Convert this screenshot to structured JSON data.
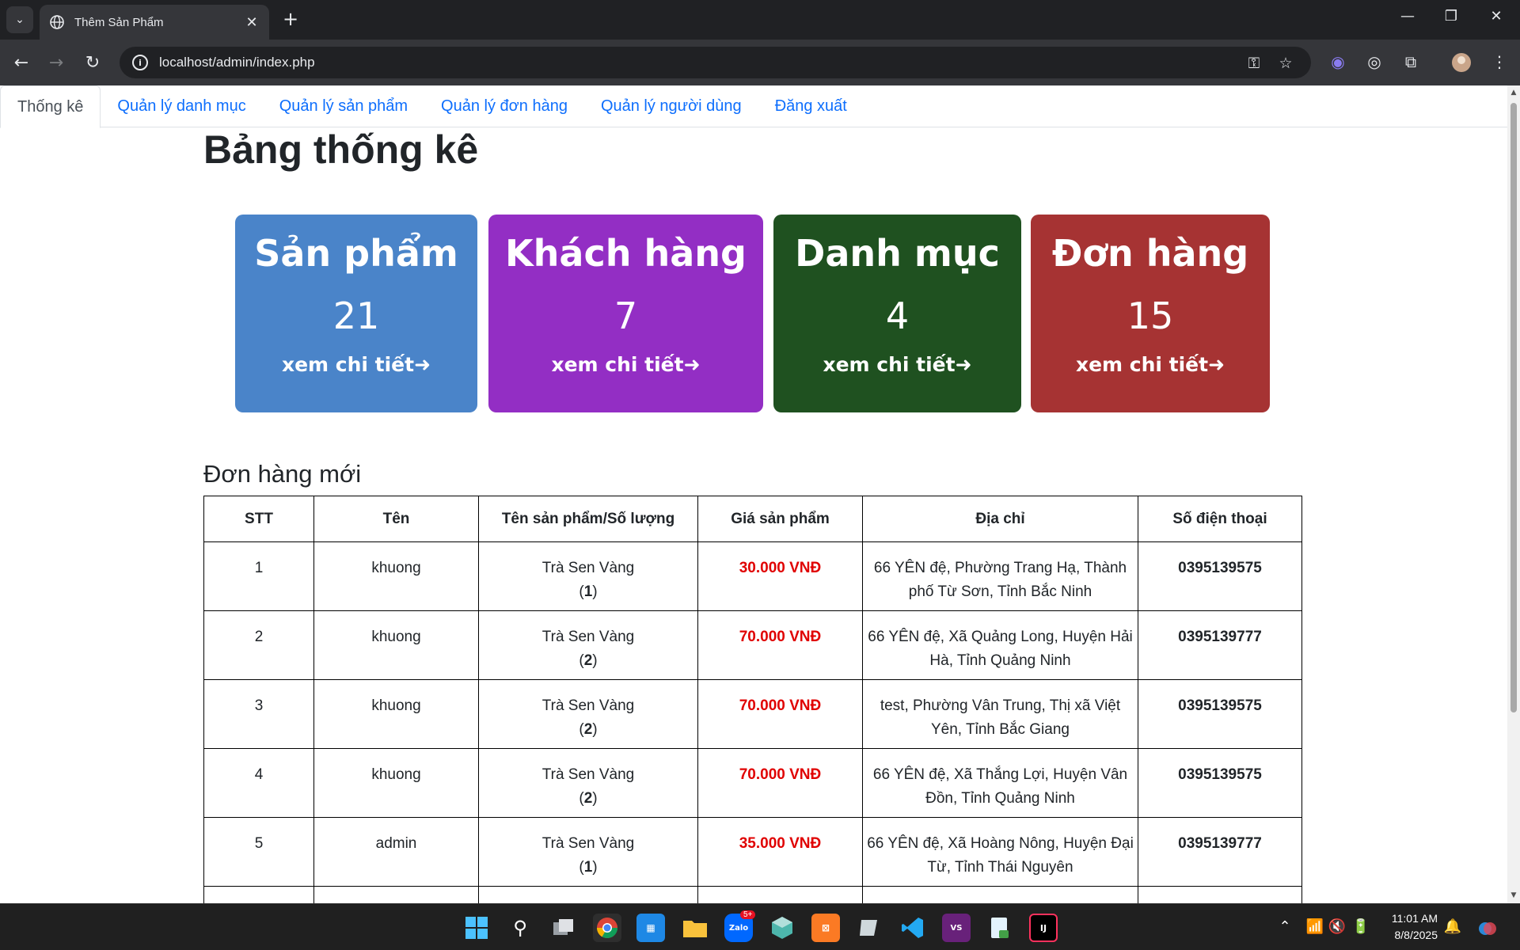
{
  "browser": {
    "tab_title": "Thêm Sản Phẩm",
    "url": "localhost/admin/index.php"
  },
  "nav": {
    "items": [
      {
        "label": "Thống kê",
        "active": true
      },
      {
        "label": "Quản lý danh mục",
        "active": false
      },
      {
        "label": "Quản lý sản phẩm",
        "active": false
      },
      {
        "label": "Quản lý đơn hàng",
        "active": false
      },
      {
        "label": "Quản lý người dùng",
        "active": false
      },
      {
        "label": "Đăng xuất",
        "active": false
      }
    ]
  },
  "page": {
    "title": "Bảng thống kê"
  },
  "cards": [
    {
      "title": "Sản phẩm",
      "value": "21",
      "link": "xem chi tiết➜",
      "color": "#4a84c9"
    },
    {
      "title": "Khách hàng",
      "value": "7",
      "link": "xem chi tiết➜",
      "color": "#932ec4"
    },
    {
      "title": "Danh mục",
      "value": "4",
      "link": "xem chi tiết➜",
      "color": "#1f5120"
    },
    {
      "title": "Đơn hàng",
      "value": "15",
      "link": "xem chi tiết➜",
      "color": "#a63333"
    }
  ],
  "orders": {
    "section_title": "Đơn hàng mới",
    "columns": [
      "STT",
      "Tên",
      "Tên sản phẩm/Số lượng",
      "Giá sản phẩm",
      "Địa chỉ",
      "Số điện thoại"
    ],
    "rows": [
      {
        "stt": "1",
        "name": "khuong",
        "product": "Trà Sen Vàng",
        "qty": "1",
        "price": "30.000 VNĐ",
        "address": "66 YÊN đệ, Phường Trang Hạ, Thành phố Từ Sơn, Tỉnh Bắc Ninh",
        "phone": "0395139575"
      },
      {
        "stt": "2",
        "name": "khuong",
        "product": "Trà Sen Vàng",
        "qty": "2",
        "price": "70.000 VNĐ",
        "address": "66 YÊN đệ, Xã Quảng Long, Huyện Hải Hà, Tỉnh Quảng Ninh",
        "phone": "0395139777"
      },
      {
        "stt": "3",
        "name": "khuong",
        "product": "Trà Sen Vàng",
        "qty": "2",
        "price": "70.000 VNĐ",
        "address": "test, Phường Vân Trung, Thị xã Việt Yên, Tỉnh Bắc Giang",
        "phone": "0395139575"
      },
      {
        "stt": "4",
        "name": "khuong",
        "product": "Trà Sen Vàng",
        "qty": "2",
        "price": "70.000 VNĐ",
        "address": "66 YÊN đệ, Xã Thắng Lợi, Huyện Vân Đồn, Tỉnh Quảng Ninh",
        "phone": "0395139575"
      },
      {
        "stt": "5",
        "name": "admin",
        "product": "Trà Sen Vàng",
        "qty": "1",
        "price": "35.000 VNĐ",
        "address": "66 YÊN đệ, Xã Hoàng Nông, Huyện Đại Từ, Tỉnh Thái Nguyên",
        "phone": "0395139777"
      }
    ]
  },
  "taskbar": {
    "time": "11:01 AM",
    "date": "8/8/2025",
    "zalo_badge": "5+",
    "apps": [
      "start-icon",
      "search-icon",
      "task-view-icon",
      "chrome-icon",
      "store-icon",
      "file-explorer-icon",
      "zalo-icon",
      "cube-icon",
      "xampp-icon",
      "app-icon",
      "vscode-icon",
      "visual-studio-icon",
      "notepad-icon",
      "intellij-icon"
    ]
  }
}
